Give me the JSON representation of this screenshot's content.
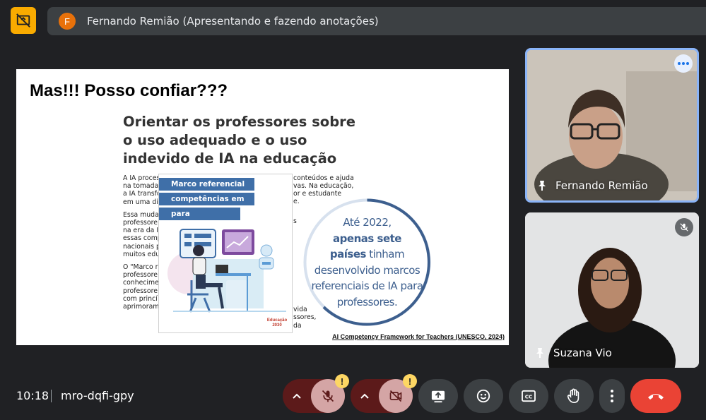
{
  "header": {
    "presenter_initial": "F",
    "presenting_text": "Fernando Remião (Apresentando e fazendo anotações)"
  },
  "slide": {
    "title": "Mas!!! Posso confiar???",
    "heading": "Orientar os professores sobre o uso adequado e o uso indevido de IA na educação",
    "body_lines": [
      "A IA proces",
      "na tomada",
      "a IA transfo",
      "em uma di",
      "Essa muda",
      "professore",
      "na era da I",
      "essas comp",
      "nacionais p",
      "muitos edu",
      "O \"Marco r",
      "professore",
      "conhecime",
      "professore",
      "com princí",
      "aprimoram"
    ],
    "right_fragments": [
      "conteúdos e ajuda",
      "vas. Na educação,",
      "or e estudante",
      "e.",
      "s",
      "vida",
      "ssores,",
      "da"
    ],
    "cover_tags": [
      "Marco referencial de",
      "competências em IA",
      "para professores"
    ],
    "cover_logo": "Educação 2030",
    "circle_lines": [
      "Até 2022,",
      "apenas sete",
      "países",
      "tinham",
      "desenvolvido marcos",
      "referenciais de IA para",
      "professores."
    ],
    "citation": "AI Competency Framework for Teachers (UNESCO, 2024)"
  },
  "participants": [
    {
      "name": "Fernando Remião",
      "active_speaker": true
    },
    {
      "name": "Suzana Vio",
      "muted": true
    }
  ],
  "footer": {
    "time": "10:18",
    "meeting_code": "mro-dqfi-gpy",
    "warning_symbol": "!"
  },
  "colors": {
    "accent": "#8ab4f8",
    "end_call": "#ea4335",
    "muted_bg": "#5c1a1a",
    "warning": "#fdd663",
    "slide_blue": "#3d5f8e"
  },
  "icons": [
    "meet-present-icon",
    "more-vert-icon",
    "pin-icon",
    "mic-off-icon",
    "caret-up-icon",
    "video-off-icon",
    "present-screen-icon",
    "emoji-icon",
    "captions-icon",
    "raise-hand-icon",
    "more-options-icon",
    "end-call-icon"
  ]
}
